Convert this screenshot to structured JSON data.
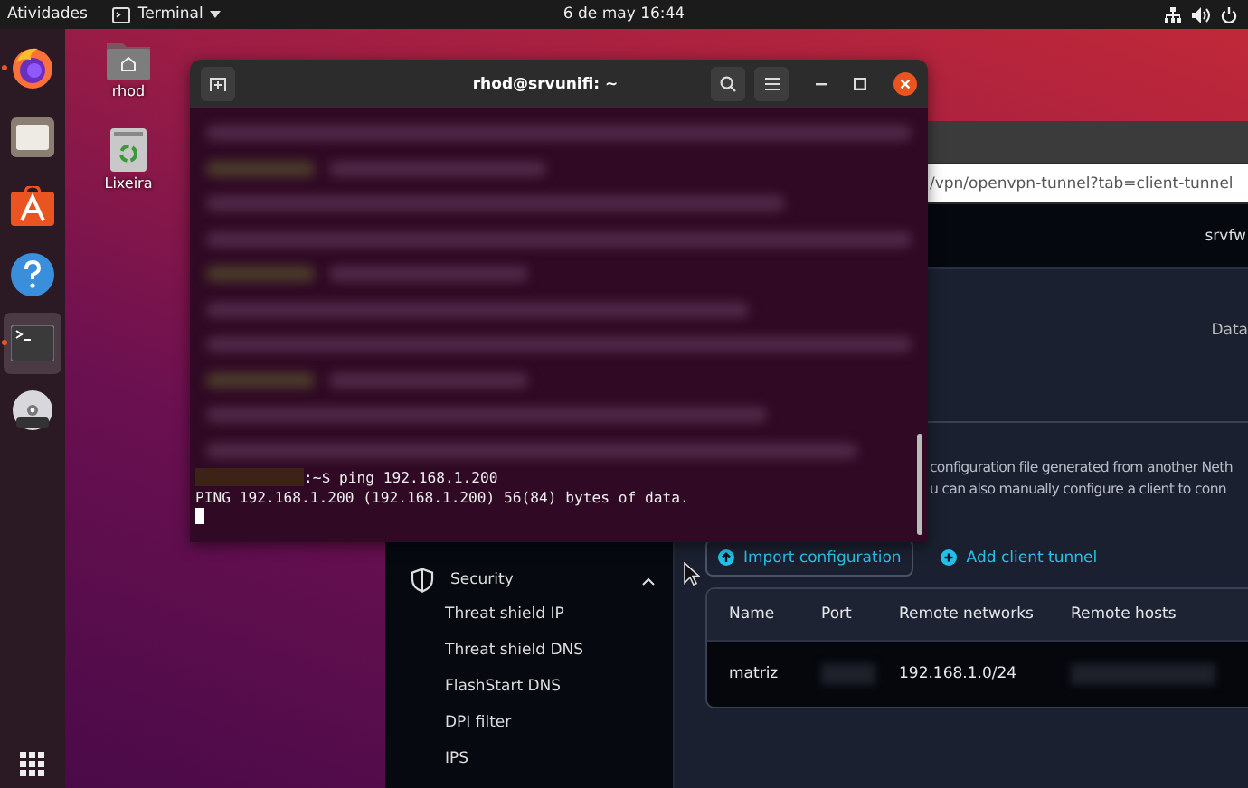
{
  "top_bar": {
    "activities": "Atividades",
    "app_menu": "Terminal",
    "clock": "6 de may  16:44"
  },
  "dock": {
    "items": [
      {
        "kind": "firefox",
        "running": true,
        "selected": false
      },
      {
        "kind": "files",
        "running": false,
        "selected": false
      },
      {
        "kind": "store",
        "running": false,
        "selected": false
      },
      {
        "kind": "help",
        "running": false,
        "selected": false
      },
      {
        "kind": "terminal",
        "running": true,
        "selected": true
      },
      {
        "kind": "dvd",
        "running": false,
        "selected": false
      }
    ]
  },
  "desktop_icons": [
    {
      "kind": "home",
      "label": "rhod"
    },
    {
      "kind": "trash",
      "label": "Lixeira"
    }
  ],
  "browser": {
    "url": "/vpn/openvpn-tunnel?tab=client-tunnel",
    "header_text": "srvfw",
    "summary_label": "Data",
    "description_lines": [
      "configuration file generated from another Neth",
      "u can also manually configure a client to conn"
    ],
    "buttons": [
      {
        "kind": "outlined",
        "label": "Import configuration"
      },
      {
        "kind": "text",
        "label": "Add client tunnel"
      }
    ],
    "sidebar": {
      "section": "Security",
      "expanded": true,
      "items": [
        "Threat shield IP",
        "Threat shield DNS",
        "FlashStart DNS",
        "DPI filter",
        "IPS"
      ]
    },
    "table": {
      "columns": [
        "Name",
        "Port",
        "Remote networks",
        "Remote hosts"
      ],
      "rows": [
        {
          "cells": [
            {
              "text": "matriz"
            },
            {
              "redacted": true
            },
            {
              "text": "192.168.1.0/24"
            },
            {
              "redacted": true
            }
          ]
        }
      ]
    }
  },
  "terminal": {
    "title": "rhod@srvunifi: ~",
    "lines": [
      {
        "kind": "blurred"
      },
      {
        "kind": "blurred-prompt"
      },
      {
        "kind": "blurred"
      },
      {
        "kind": "blurred"
      },
      {
        "kind": "blurred-prompt"
      },
      {
        "kind": "blurred"
      },
      {
        "kind": "blurred"
      },
      {
        "kind": "blurred-prompt"
      },
      {
        "kind": "blurred"
      },
      {
        "kind": "blurred"
      },
      {
        "kind": "prompt",
        "text": ":~$ ping 192.168.1.200"
      },
      {
        "kind": "output",
        "text": "PING 192.168.1.200 (192.168.1.200) 56(84) bytes of data."
      },
      {
        "kind": "cursor"
      }
    ]
  }
}
